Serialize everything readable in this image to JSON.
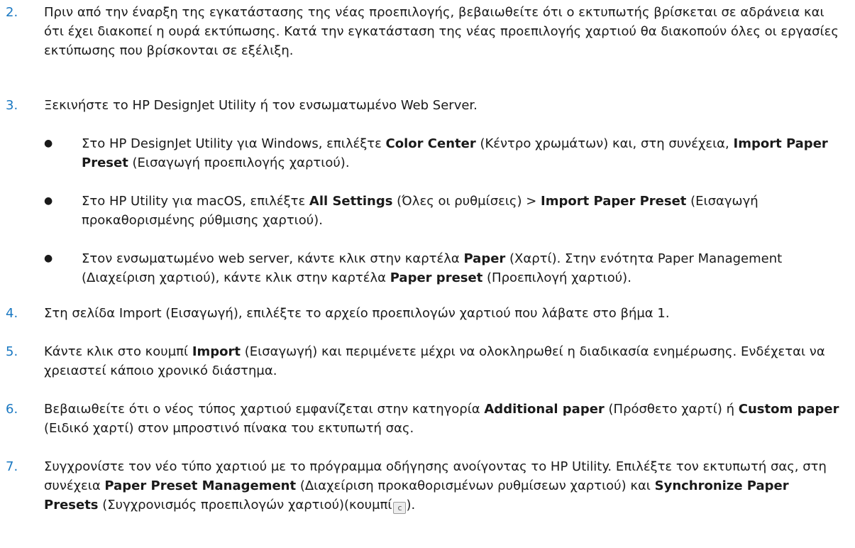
{
  "steps": {
    "s2": {
      "num": "2.",
      "text": "Πριν από την έναρξη της εγκατάστασης της νέας προεπιλογής, βεβαιωθείτε ότι ο εκτυπωτής βρίσκεται σε αδράνεια και ότι έχει διακοπεί η ουρά εκτύπωσης. Κατά την εγκατάσταση της νέας προεπιλογής χαρτιού θα διακοπούν όλες οι εργασίες εκτύπωσης που βρίσκονται σε εξέλιξη."
    },
    "s3": {
      "num": "3.",
      "text": "Ξεκινήστε το HP DesignJet Utility ή τον ενσωματωμένο Web Server.",
      "bullets": {
        "b1": {
          "dot": "●",
          "p1": "Στο HP DesignJet Utility για Windows, επιλέξτε ",
          "k1": "Color Center",
          "p2": " (Κέντρο χρωμάτων) και, στη συνέχεια, ",
          "k2": "Import Paper Preset",
          "p3": " (Εισαγωγή προεπιλογής χαρτιού)."
        },
        "b2": {
          "dot": "●",
          "p1": "Στο HP Utility για macOS, επιλέξτε ",
          "k1": "All Settings",
          "p2": " (Όλες οι ρυθμίσεις) > ",
          "k2": "Import Paper Preset",
          "p3": " (Εισαγωγή προκαθορισμένης ρύθμισης χαρτιού)."
        },
        "b3": {
          "dot": "●",
          "p1": "Στον ενσωματωμένο web server, κάντε κλικ στην καρτέλα ",
          "k1": "Paper",
          "p2": " (Χαρτί). Στην ενότητα Paper Management (Διαχείριση χαρτιού), κάντε κλικ στην καρτέλα ",
          "k2": "Paper preset",
          "p3": " (Προεπιλογή χαρτιού)."
        }
      }
    },
    "s4": {
      "num": "4.",
      "text": "Στη σελίδα Import (Εισαγωγή), επιλέξτε το αρχείο προεπιλογών χαρτιού που λάβατε στο βήμα 1."
    },
    "s5": {
      "num": "5.",
      "p1": "Κάντε κλικ στο κουμπί ",
      "k1": "Import",
      "p2": " (Εισαγωγή) και περιμένετε μέχρι να ολοκληρωθεί η διαδικασία ενημέρωσης. Ενδέχεται να χρειαστεί κάποιο χρονικό διάστημα."
    },
    "s6": {
      "num": "6.",
      "p1": "Βεβαιωθείτε ότι ο νέος τύπος χαρτιού εμφανίζεται στην κατηγορία ",
      "k1": "Additional paper",
      "p2": " (Πρόσθετο χαρτί) ή ",
      "k2": "Custom paper",
      "p3": " (Ειδικό χαρτί) στον μπροστινό πίνακα του εκτυπωτή σας."
    },
    "s7": {
      "num": "7.",
      "p1": "Συγχρονίστε τον νέο τύπο χαρτιού με το πρόγραμμα οδήγησης ανοίγοντας το HP Utility. Επιλέξτε τον εκτυπωτή σας, στη συνέχεια ",
      "k1": "Paper Preset Management",
      "p2": " (Διαχείριση προκαθορισμένων ρυθμίσεων χαρτιού) και ",
      "k2": "Synchronize Paper Presets",
      "p3": " (Συγχρονισμός προεπιλογών χαρτιού)(κουμπί",
      "icon_glyph": "c",
      "p4": ")."
    }
  },
  "icons": {
    "sync_button": "refresh-icon"
  },
  "colors": {
    "step_number": "#1a78c2",
    "text": "#1a1a1a"
  }
}
